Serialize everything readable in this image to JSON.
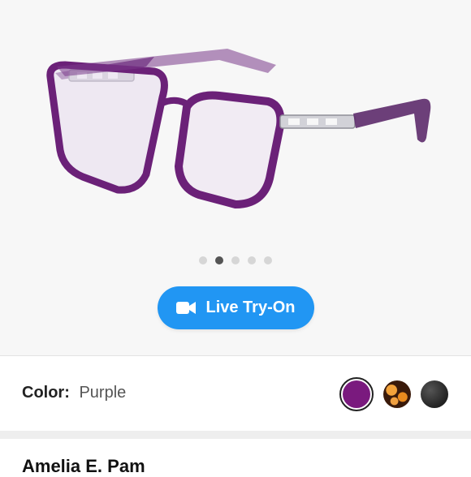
{
  "product": {
    "image_alt": "Purple cat-eye eyeglasses frame with silver chain-link temples",
    "name": "Amelia E. Pam"
  },
  "carousel": {
    "total": 5,
    "active_index": 1
  },
  "try_on": {
    "label": "Live Try-On",
    "icon": "video-camera-icon"
  },
  "color": {
    "label": "Color:",
    "selected": "Purple",
    "swatches": [
      {
        "name": "purple",
        "hex": "#7a1a7e",
        "selected": true
      },
      {
        "name": "tortoise",
        "hex": "#3a1a0a",
        "selected": false
      },
      {
        "name": "black",
        "hex": "#2a2a2a",
        "selected": false
      }
    ]
  },
  "colors": {
    "accent": "#2196f3",
    "background": "#f7f7f7"
  }
}
